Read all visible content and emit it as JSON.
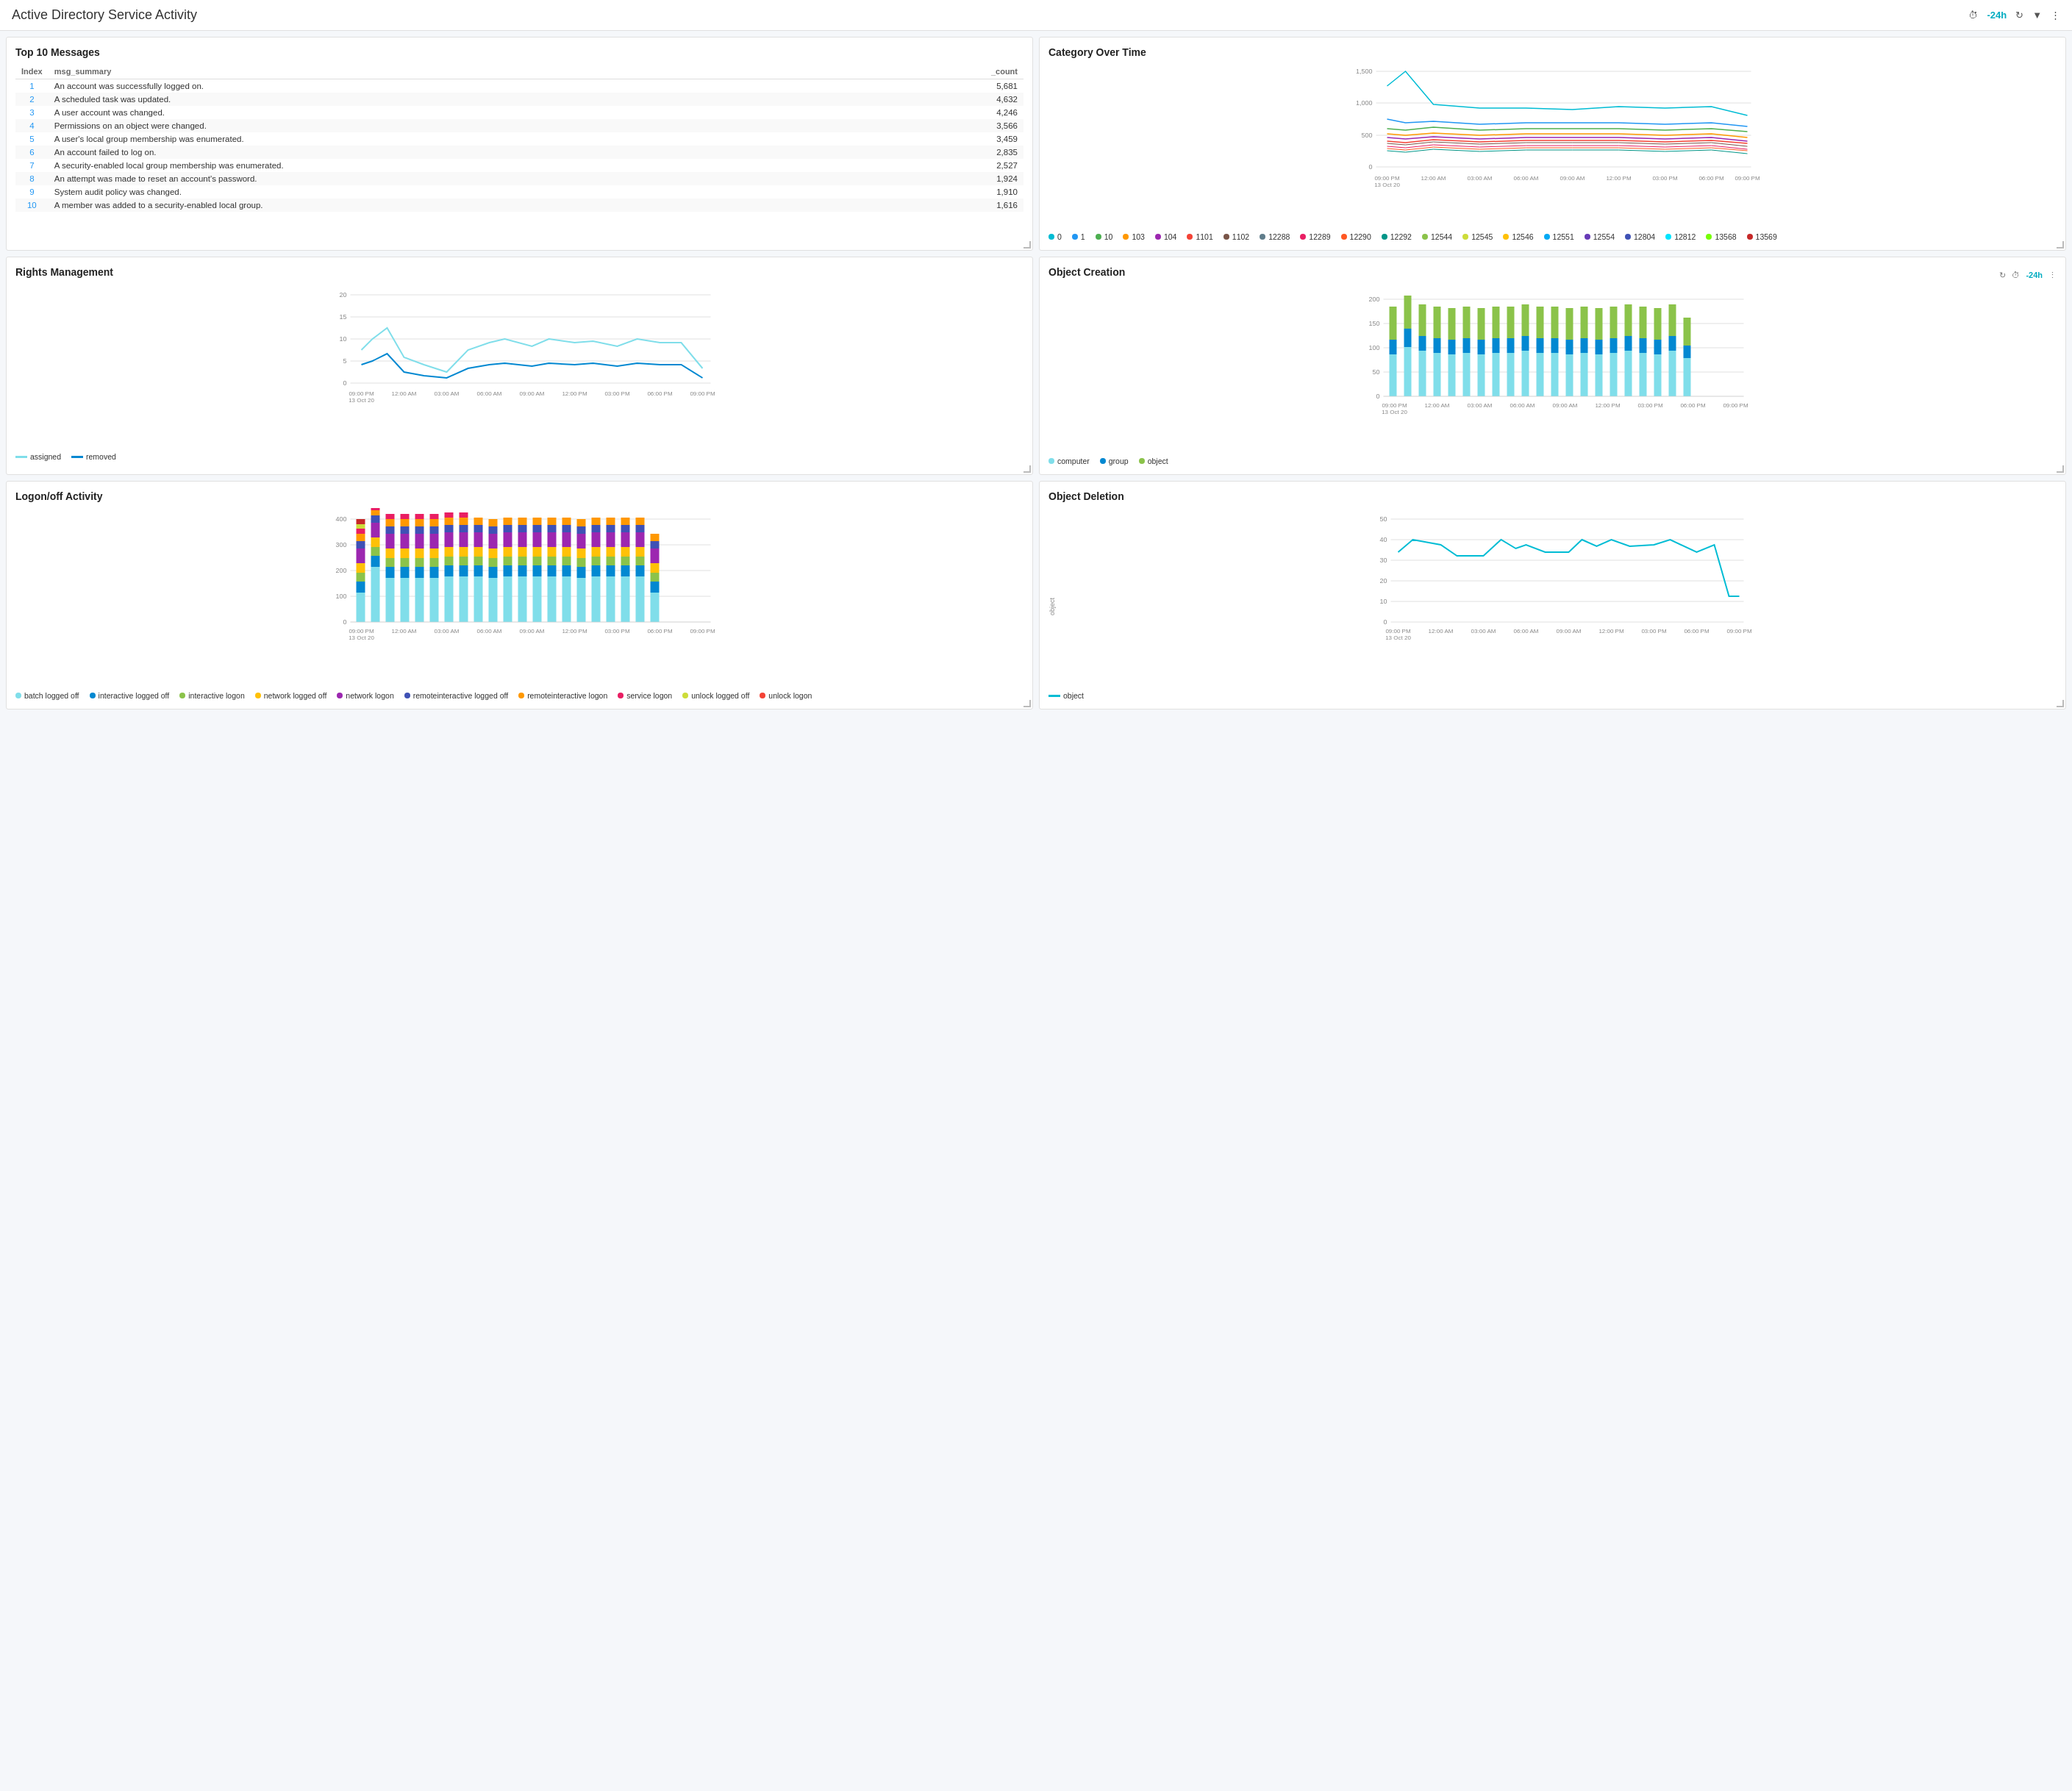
{
  "header": {
    "title": "Active Directory Service Activity",
    "timeRange": "-24h",
    "controls": [
      "refresh-icon",
      "filter-icon",
      "menu-icon"
    ]
  },
  "topMessages": {
    "title": "Top 10 Messages",
    "columns": [
      "Index",
      "msg_summary",
      "_count"
    ],
    "rows": [
      {
        "index": 1,
        "msg": "An account was successfully logged on.",
        "count": "5,681"
      },
      {
        "index": 2,
        "msg": "A scheduled task was updated.",
        "count": "4,632"
      },
      {
        "index": 3,
        "msg": "A user account was changed.",
        "count": "4,246"
      },
      {
        "index": 4,
        "msg": "Permissions on an object were changed.",
        "count": "3,566"
      },
      {
        "index": 5,
        "msg": "A user's local group membership was enumerated.",
        "count": "3,459"
      },
      {
        "index": 6,
        "msg": "An account failed to log on.",
        "count": "2,835"
      },
      {
        "index": 7,
        "msg": "A security-enabled local group membership was enumerated.",
        "count": "2,527"
      },
      {
        "index": 8,
        "msg": "An attempt was made to reset an account's password.",
        "count": "1,924"
      },
      {
        "index": 9,
        "msg": "System audit policy was changed.",
        "count": "1,910"
      },
      {
        "index": 10,
        "msg": "A member was added to a security-enabled local group.",
        "count": "1,616"
      }
    ]
  },
  "categoryOverTime": {
    "title": "Category Over Time",
    "yMax": 1500,
    "yTicks": [
      "1,500",
      "1,000",
      "500",
      "0"
    ],
    "xLabels": [
      "09:00 PM\n13 Oct 20",
      "12:00 AM",
      "03:00 AM",
      "06:00 AM",
      "09:00 AM",
      "12:00 PM",
      "03:00 PM",
      "06:00 PM",
      "09:00 PM"
    ],
    "legend": [
      {
        "label": "0",
        "color": "#00bcd4"
      },
      {
        "label": "1",
        "color": "#2196F3"
      },
      {
        "label": "10",
        "color": "#4CAF50"
      },
      {
        "label": "103",
        "color": "#FF9800"
      },
      {
        "label": "104",
        "color": "#9C27B0"
      },
      {
        "label": "1101",
        "color": "#F44336"
      },
      {
        "label": "1102",
        "color": "#795548"
      },
      {
        "label": "12288",
        "color": "#607D8B"
      },
      {
        "label": "12289",
        "color": "#E91E63"
      },
      {
        "label": "12290",
        "color": "#FF5722"
      },
      {
        "label": "12292",
        "color": "#009688"
      },
      {
        "label": "12544",
        "color": "#8BC34A"
      },
      {
        "label": "12545",
        "color": "#CDDC39"
      },
      {
        "label": "12546",
        "color": "#FFC107"
      },
      {
        "label": "12551",
        "color": "#03A9F4"
      },
      {
        "label": "12554",
        "color": "#673AB7"
      },
      {
        "label": "12804",
        "color": "#3F51B5"
      },
      {
        "label": "12812",
        "color": "#00E5FF"
      },
      {
        "label": "13568",
        "color": "#76FF03"
      },
      {
        "label": "13569",
        "color": "#C62828"
      }
    ]
  },
  "rightsManagement": {
    "title": "Rights Management",
    "yMax": 20,
    "yTicks": [
      "20",
      "15",
      "10",
      "5",
      "0"
    ],
    "xLabels": [
      "09:00 PM\n13 Oct 20",
      "12:00 AM",
      "03:00 AM",
      "06:00 AM",
      "09:00 AM",
      "12:00 PM",
      "03:00 PM",
      "06:00 PM",
      "09:00 PM"
    ],
    "legend": [
      {
        "label": "assigned",
        "color": "#80DEEA"
      },
      {
        "label": "removed",
        "color": "#0288D1"
      }
    ]
  },
  "objectCreation": {
    "title": "Object Creation",
    "timeRange": "-24h",
    "yMax": 200,
    "yTicks": [
      "200",
      "150",
      "100",
      "50",
      "0"
    ],
    "xLabels": [
      "09:00 PM\n13 Oct 20",
      "12:00 AM",
      "03:00 AM",
      "06:00 AM",
      "09:00 AM",
      "12:00 PM",
      "03:00 PM",
      "06:00 PM",
      "09:00 PM"
    ],
    "legend": [
      {
        "label": "computer",
        "color": "#80DEEA"
      },
      {
        "label": "group",
        "color": "#0288D1"
      },
      {
        "label": "object",
        "color": "#8BC34A"
      }
    ]
  },
  "logonActivity": {
    "title": "Logon/off Activity",
    "yMax": 400,
    "yTicks": [
      "400",
      "300",
      "200",
      "100",
      "0"
    ],
    "xLabels": [
      "09:00 PM\n13 Oct 20",
      "12:00 AM",
      "03:00 AM",
      "06:00 AM",
      "09:00 AM",
      "12:00 PM",
      "03:00 PM",
      "06:00 PM",
      "09:00 PM"
    ],
    "legend": [
      {
        "label": "batch logged off",
        "color": "#80DEEA"
      },
      {
        "label": "interactive logged off",
        "color": "#0288D1"
      },
      {
        "label": "interactive logon",
        "color": "#8BC34A"
      },
      {
        "label": "network logged off",
        "color": "#FFC107"
      },
      {
        "label": "network logon",
        "color": "#9C27B0"
      },
      {
        "label": "remoteinteractive logged off",
        "color": "#3F51B5"
      },
      {
        "label": "remoteinteractive logon",
        "color": "#FF9800"
      },
      {
        "label": "service logon",
        "color": "#E91E63"
      },
      {
        "label": "unlock logged off",
        "color": "#CDDC39"
      },
      {
        "label": "unlock logon",
        "color": "#F44336"
      }
    ]
  },
  "objectDeletion": {
    "title": "Object Deletion",
    "yLabel": "object",
    "yMax": 50,
    "yTicks": [
      "50",
      "40",
      "30",
      "20",
      "10",
      "0"
    ],
    "xLabels": [
      "09:00 PM\n13 Oct 20",
      "12:00 AM",
      "03:00 AM",
      "06:00 AM",
      "09:00 AM",
      "12:00 PM",
      "03:00 PM",
      "06:00 PM",
      "09:00 PM"
    ],
    "legend": [
      {
        "label": "object",
        "color": "#00bcd4"
      }
    ]
  }
}
